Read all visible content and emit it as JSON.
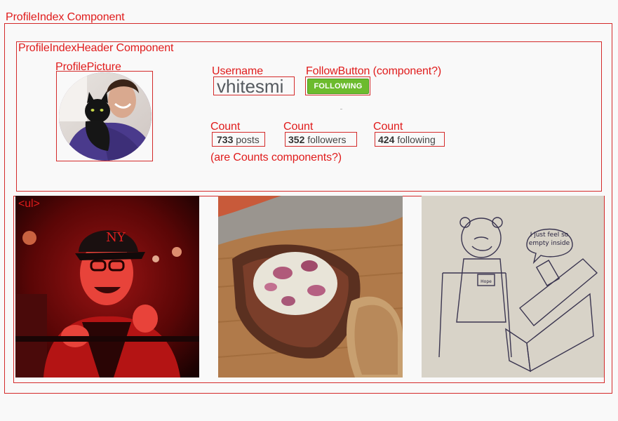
{
  "annotations": {
    "profile_index": "ProfileIndex Component",
    "profile_index_header": "ProfileIndexHeader Component",
    "profile_picture": "ProfilePicture",
    "username": "Username",
    "follow_button": "FollowButton (component?)",
    "count_1": "Count",
    "count_2": "Count",
    "count_3": "Count",
    "counts_question": "(are Counts components?)",
    "ul": "<ul>"
  },
  "profile": {
    "username": "vhitesmi",
    "follow_button_label": "FOLLOWING",
    "counts": [
      {
        "number": "733",
        "label": "posts"
      },
      {
        "number": "352",
        "label": "followers"
      },
      {
        "number": "424",
        "label": "following"
      }
    ]
  },
  "photo_text": {
    "sketch_caption_1": "I just feel so",
    "sketch_caption_2": "empty inside",
    "sketch_sign": "Hope"
  },
  "colors": {
    "annotation": "#e01b1b",
    "follow_button": "#6cbb2e",
    "username": "#555a5f"
  }
}
